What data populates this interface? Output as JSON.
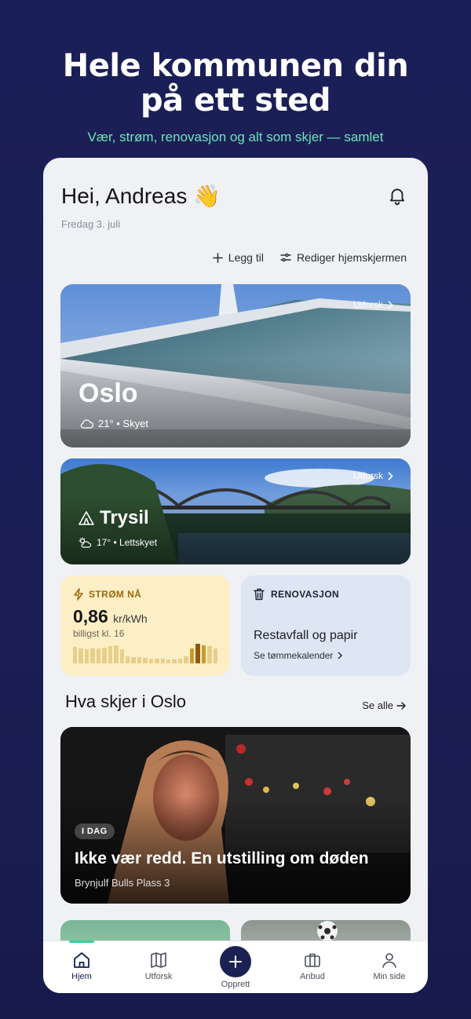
{
  "hero": {
    "title_line1": "Hele kommunen din",
    "title_line2": "på ett sted",
    "subtitle": "Vær, strøm, renovasjon og alt som skjer — samlet"
  },
  "header": {
    "greeting": "Hei, Andreas",
    "wave": "👋",
    "date": "Fredag 3. juli"
  },
  "actions": {
    "add": "Legg til",
    "edit": "Rediger hjemskjermen"
  },
  "cities": [
    {
      "name": "Oslo",
      "weather": "21° • Skyet",
      "explore": "Utforsk"
    },
    {
      "name": "Trysil",
      "weather": "17° • Lettskyet",
      "explore": "Utforsk"
    }
  ],
  "strom": {
    "label": "STRØM NÅ",
    "price": "0,86",
    "unit": "kr/kWh",
    "cheapest": "billigst kl. 16",
    "bars": [
      0.8,
      0.75,
      0.7,
      0.72,
      0.75,
      0.78,
      0.85,
      0.9,
      0.7,
      0.35,
      0.3,
      0.3,
      0.28,
      0.25,
      0.25,
      0.22,
      0.2,
      0.2,
      0.22,
      0.35,
      0.75,
      0.95,
      0.9,
      0.85,
      0.75
    ],
    "bar_color": "#e6cf8b",
    "highlight_color": "#c99a2e",
    "current_color": "#8a5a10"
  },
  "renovasjon": {
    "label": "RENOVASJON",
    "title": "Restavfall og papir",
    "link": "Se tømmekalender"
  },
  "section": {
    "title": "Hva skjer i Oslo",
    "see_all": "Se alle"
  },
  "event": {
    "badge": "I DAG",
    "title": "Ikke vær redd. En utstilling om døden",
    "place": "Brynjulf Bulls Plass 3"
  },
  "tabs": [
    {
      "label": "Hjem",
      "icon": "home-icon"
    },
    {
      "label": "Utforsk",
      "icon": "map-icon"
    },
    {
      "label": "Opprett",
      "icon": "plus-icon"
    },
    {
      "label": "Anbud",
      "icon": "briefcase-icon"
    },
    {
      "label": "Min side",
      "icon": "person-icon"
    }
  ],
  "colors": {
    "accent": "#34d399",
    "navy": "#1c2153",
    "subtitle": "#6ee7b7"
  }
}
